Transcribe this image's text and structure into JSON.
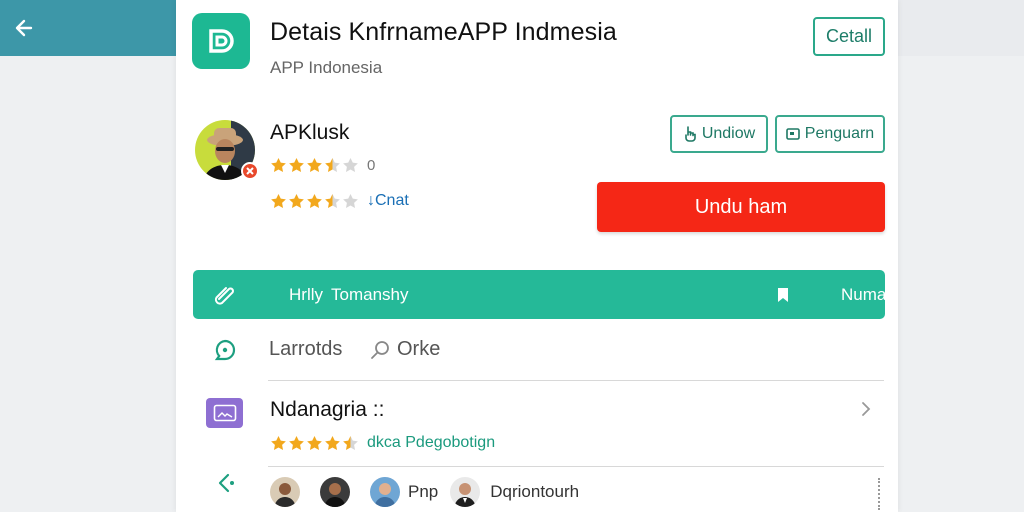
{
  "header": {
    "title": "Detais KnfrnameAPP Indmesia",
    "subtitle": "APP Indonesia",
    "detail_button": "Cetall"
  },
  "developer": {
    "name": "APKlusk",
    "rating1_stars": 3.5,
    "rating1_count": "0",
    "rating2_stars": 3.5,
    "rating2_link": "↓Cnat"
  },
  "actions": {
    "button1": "Undiow",
    "button2": "Penguarn",
    "download": "Undu ham"
  },
  "teal_bar": {
    "label1": "Hrlly",
    "label2": "Tomanshy",
    "label3": "Numa"
  },
  "row1": {
    "text1": "Larrotds",
    "text2": "Orke"
  },
  "row2": {
    "name": "Ndanagria ::",
    "stars": 4.5,
    "link": "dkca Pdegobotign"
  },
  "row3": {
    "label1": "Pnp",
    "label2": "Dqriontourh"
  },
  "colors": {
    "accent": "#25b998",
    "download": "#f52716",
    "star": "#f2a81d",
    "topbar": "#3d97a8"
  }
}
